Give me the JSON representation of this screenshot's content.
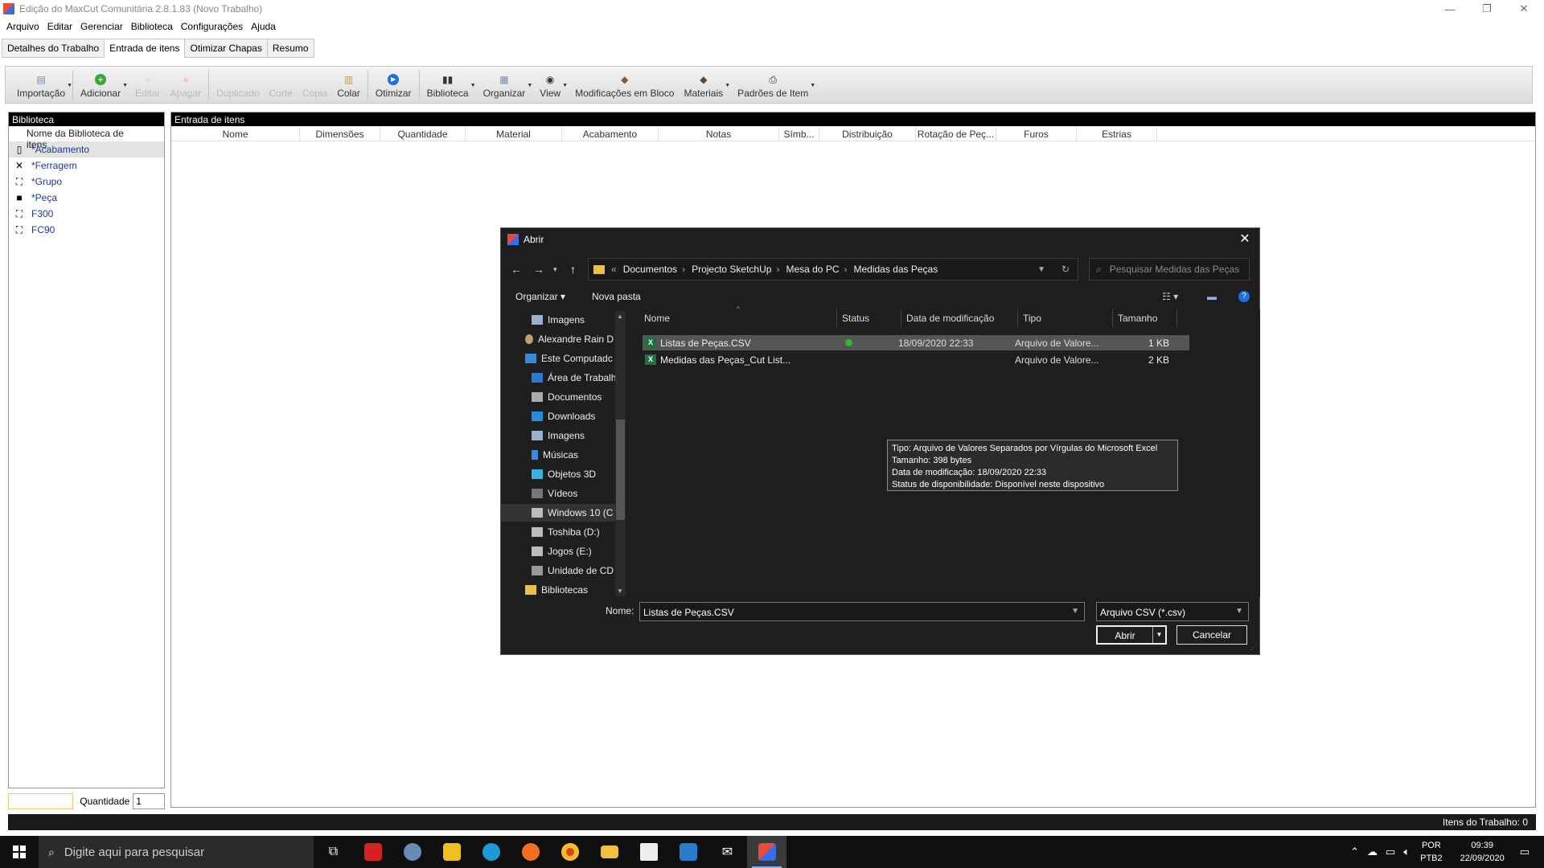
{
  "window": {
    "title": "Edição do MaxCut Comunitária 2.8.1.83 (Novo Trabalho)",
    "minimize": "—",
    "restore": "❐",
    "close": "✕"
  },
  "menu": [
    "Arquivo",
    "Editar",
    "Gerenciar",
    "Biblioteca",
    "Configurações",
    "Ajuda"
  ],
  "tabs": [
    {
      "label": "Detalhes do Trabalho",
      "active": false
    },
    {
      "label": "Entrada de itens",
      "active": true
    },
    {
      "label": "Otimizar Chapas",
      "active": false
    },
    {
      "label": "Resumo",
      "active": false
    }
  ],
  "toolbar": {
    "importacao": "Importação",
    "adicionar": "Adicionar",
    "editar": "Editar",
    "apagar": "Apagar",
    "duplicado": "Duplicado",
    "corte": "Corte",
    "copia": "Cópia",
    "colar": "Colar",
    "otimizar": "Otimizar",
    "biblioteca": "Biblioteca",
    "organizar": "Organizar",
    "view": "View",
    "modificacoes": "Modificações em Bloco",
    "materiais": "Materiais",
    "padroes": "Padrões de Item"
  },
  "library": {
    "header": "Biblioteca",
    "column": "Nome da Biblioteca de itens",
    "items": [
      "*Acabamento",
      "*Ferragem",
      "*Grupo",
      "*Peça",
      "F300",
      "FC90"
    ]
  },
  "entry": {
    "header": "Entrada de itens",
    "columns": [
      "Nome",
      "Dimensões",
      "Quantidade",
      "Material",
      "Acabamento",
      "Notas",
      "Símb...",
      "Distribuição",
      "Rotação de Peç...",
      "Furos",
      "Estrias"
    ]
  },
  "quantity": {
    "label": "Quantidade",
    "value": "1"
  },
  "status": {
    "items": "Itens do Trabalho: 0"
  },
  "dialog": {
    "title": "Abrir",
    "close": "✕",
    "breadcrumb": [
      "Documentos",
      "Projecto SketchUp",
      "Mesa do PC",
      "Medidas das Peças"
    ],
    "search_placeholder": "Pesquisar Medidas das Peças",
    "organize": "Organizar ▾",
    "new_folder": "Nova pasta",
    "nav": [
      "Imagens",
      "Alexandre Rain D",
      "Este Computadc",
      "Área de Trabalh",
      "Documentos",
      "Downloads",
      "Imagens",
      "Músicas",
      "Objetos 3D",
      "Vídeos",
      "Windows 10 (C",
      "Toshiba (D:)",
      "Jogos (E:)",
      "Unidade de CD",
      "Bibliotecas"
    ],
    "columns": [
      "Nome",
      "Status",
      "Data de modificação",
      "Tipo",
      "Tamanho"
    ],
    "files": [
      {
        "name": "Listas de Peças.CSV",
        "date": "18/09/2020 22:33",
        "type": "Arquivo de Valore...",
        "size": "1 KB"
      },
      {
        "name": "Medidas das Peças_Cut List...",
        "date": "",
        "type": "Arquivo de Valore...",
        "size": "2 KB"
      }
    ],
    "tooltip": [
      "Tipo: Arquivo de Valores Separados por Vírgulas do Microsoft Excel",
      "Tamanho: 398 bytes",
      "Data de modificação: 18/09/2020 22:33",
      "Status de disponibilidade: Disponível neste dispositivo"
    ],
    "name_label": "Nome:",
    "name_value": "Listas de Peças.CSV",
    "filter": "Arquivo CSV (*.csv)",
    "open": "Abrir",
    "cancel": "Cancelar"
  },
  "taskbar": {
    "search": "Digite aqui para pesquisar",
    "lang": "POR",
    "kbd": "PTB2",
    "time": "09:39",
    "date": "22/09/2020"
  }
}
